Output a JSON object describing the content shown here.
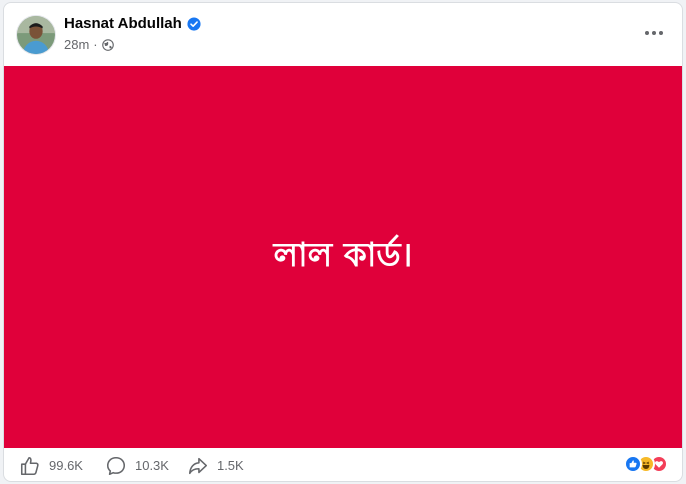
{
  "post": {
    "author": "Hasnat Abdullah",
    "time": "28m",
    "separator": "·",
    "verified_icon": "verified-badge-icon",
    "privacy_icon": "globe-icon",
    "more_icon": "more-options-icon"
  },
  "banner": {
    "text": "লাল কার্ড।",
    "background": "#e0003a",
    "text_color": "#ffffff"
  },
  "actions": {
    "likes": "99.6K",
    "comments": "10.3K",
    "shares": "1.5K"
  },
  "reactions": [
    {
      "type": "like",
      "icon": "like-reaction-icon",
      "color": "#1877f2"
    },
    {
      "type": "haha",
      "icon": "haha-reaction-icon",
      "color": "#f7b928"
    },
    {
      "type": "love",
      "icon": "love-reaction-icon",
      "color": "#f33e58"
    }
  ],
  "colors": {
    "accent": "#1877f2",
    "secondary_text": "#65676b"
  }
}
